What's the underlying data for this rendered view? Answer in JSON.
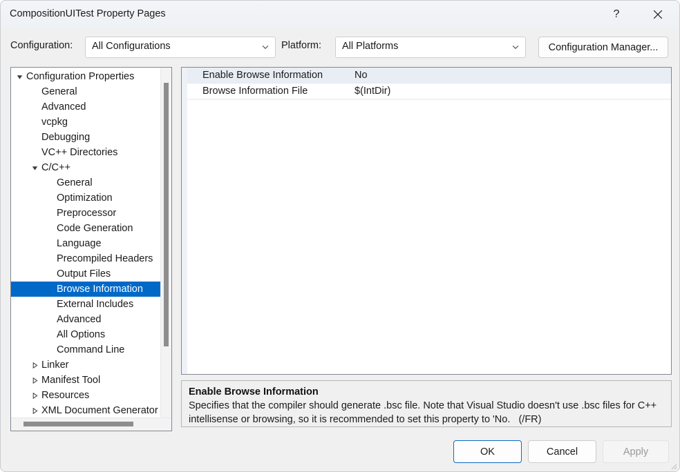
{
  "window": {
    "title": "CompositionUITest Property Pages",
    "help_icon": "question-mark-icon",
    "close_icon": "close-icon"
  },
  "config_bar": {
    "configuration_label": "Configuration:",
    "configuration_value": "All Configurations",
    "platform_label": "Platform:",
    "platform_value": "All Platforms",
    "configuration_manager_label": "Configuration Manager...",
    "chevron_icon": "chevron-down-icon"
  },
  "tree": {
    "selected": "Browse Information",
    "nodes": [
      {
        "label": "Configuration Properties",
        "level": 0,
        "state": "expanded"
      },
      {
        "label": "General",
        "level": 1,
        "state": "leaf"
      },
      {
        "label": "Advanced",
        "level": 1,
        "state": "leaf"
      },
      {
        "label": "vcpkg",
        "level": 1,
        "state": "leaf"
      },
      {
        "label": "Debugging",
        "level": 1,
        "state": "leaf"
      },
      {
        "label": "VC++ Directories",
        "level": 1,
        "state": "leaf"
      },
      {
        "label": "C/C++",
        "level": 1,
        "state": "expanded"
      },
      {
        "label": "General",
        "level": 2,
        "state": "leaf"
      },
      {
        "label": "Optimization",
        "level": 2,
        "state": "leaf"
      },
      {
        "label": "Preprocessor",
        "level": 2,
        "state": "leaf"
      },
      {
        "label": "Code Generation",
        "level": 2,
        "state": "leaf"
      },
      {
        "label": "Language",
        "level": 2,
        "state": "leaf"
      },
      {
        "label": "Precompiled Headers",
        "level": 2,
        "state": "leaf"
      },
      {
        "label": "Output Files",
        "level": 2,
        "state": "leaf"
      },
      {
        "label": "Browse Information",
        "level": 2,
        "state": "leaf",
        "selected": true
      },
      {
        "label": "External Includes",
        "level": 2,
        "state": "leaf"
      },
      {
        "label": "Advanced",
        "level": 2,
        "state": "leaf"
      },
      {
        "label": "All Options",
        "level": 2,
        "state": "leaf"
      },
      {
        "label": "Command Line",
        "level": 2,
        "state": "leaf"
      },
      {
        "label": "Linker",
        "level": 1,
        "state": "collapsed"
      },
      {
        "label": "Manifest Tool",
        "level": 1,
        "state": "collapsed"
      },
      {
        "label": "Resources",
        "level": 1,
        "state": "collapsed"
      },
      {
        "label": "XML Document Generator",
        "level": 1,
        "state": "collapsed"
      }
    ]
  },
  "property_grid": {
    "rows": [
      {
        "name": "Enable Browse Information",
        "value": "No",
        "selected": true
      },
      {
        "name": "Browse Information File",
        "value": "$(IntDir)",
        "selected": false
      }
    ]
  },
  "description": {
    "title": "Enable Browse Information",
    "line1": "Specifies that the compiler should generate .bsc file. Note that Visual Studio doesn't use .bsc files for",
    "line2": "C++ intellisense or browsing, so it is recommended to set this property to 'No.",
    "switch": "(/FR)"
  },
  "footer": {
    "ok_label": "OK",
    "cancel_label": "Cancel",
    "apply_label": "Apply",
    "apply_disabled": true
  },
  "colors": {
    "selection_blue": "#0069c8",
    "focus_border": "#0d6abf",
    "dialog_bg": "#f0f0f0",
    "titlebar_bg": "#f1f4f8"
  }
}
